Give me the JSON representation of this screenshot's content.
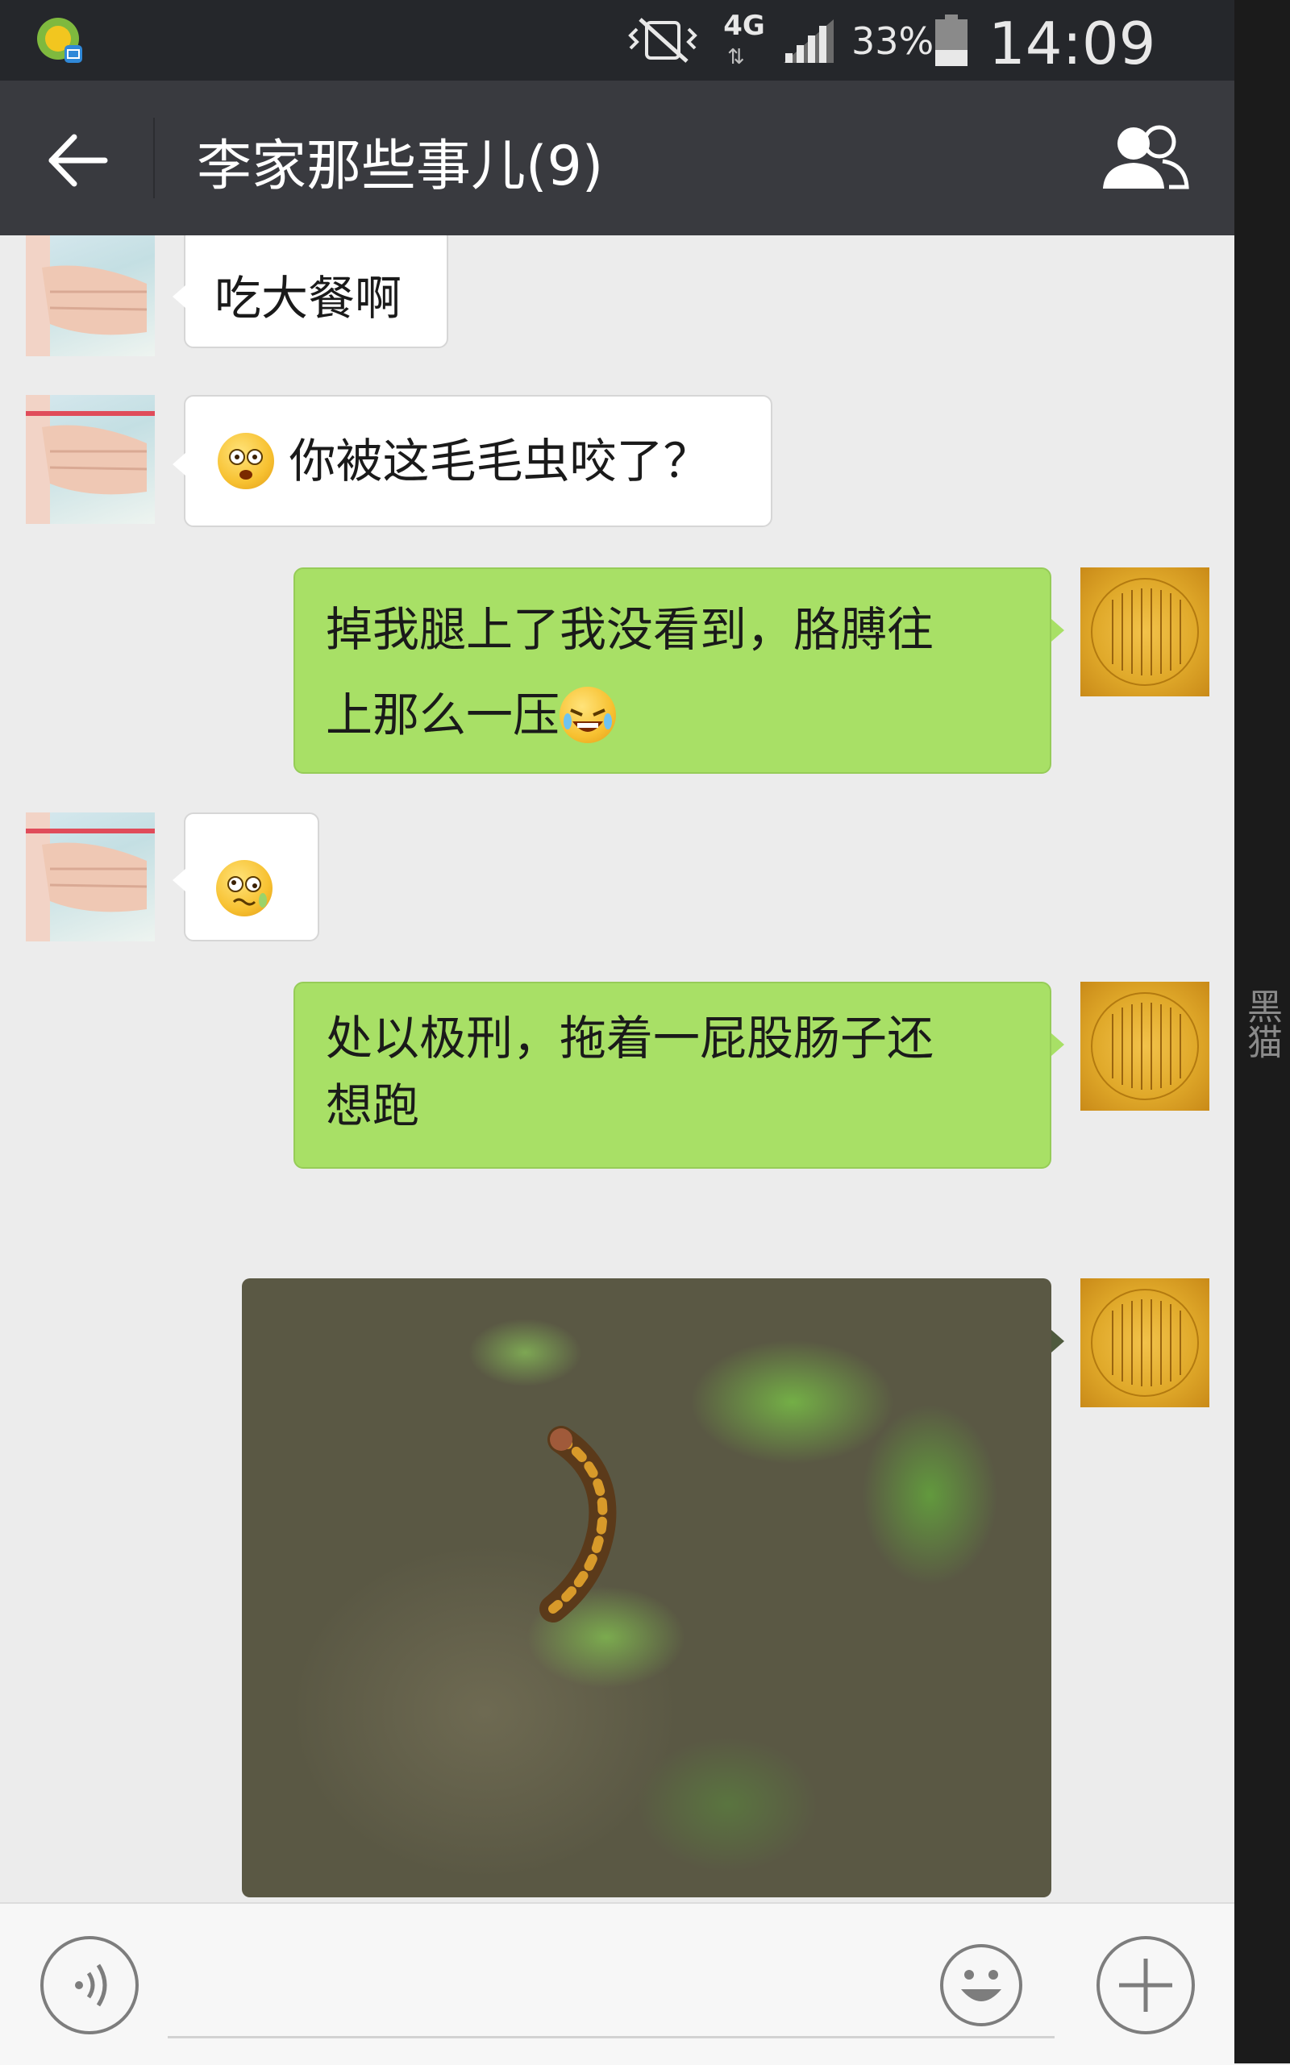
{
  "status_bar": {
    "network": "4G",
    "battery_percent": "33%",
    "time": "14:09",
    "icons": [
      "app-notification-icon",
      "vibrate-mute-icon",
      "signal-icon",
      "battery-icon"
    ]
  },
  "header": {
    "title": "李家那些事儿(9)",
    "back_icon": "back-arrow-icon",
    "members_icon": "group-members-icon"
  },
  "side_strip": {
    "text": "黑猫"
  },
  "messages": [
    {
      "sender": "friend",
      "text": "吃大餐啊"
    },
    {
      "sender": "friend",
      "emoji": "surprised-emoji",
      "text": "你被这毛毛虫咬了？"
    },
    {
      "sender": "self",
      "text_line1": "掉我腿上了我没看到，胳膊往",
      "text_line2": "上那么一压",
      "emoji": "crying-laughing-emoji"
    },
    {
      "sender": "friend",
      "emoji": "dizzy-sweat-emoji"
    },
    {
      "sender": "self",
      "text_line1": "处以极刑，拖着一屁股肠子还",
      "text_line2": "想跑"
    },
    {
      "sender": "self",
      "type": "image",
      "image_subject": "caterpillar-on-ground-photo"
    }
  ],
  "input_bar": {
    "voice_icon": "voice-input-icon",
    "emoji_icon": "emoji-picker-icon",
    "plus_icon": "more-plus-icon",
    "placeholder": ""
  },
  "colors": {
    "header_bg": "#393a3f",
    "statusbar_bg": "#25272b",
    "chat_bg": "#ececec",
    "outgoing_bubble": "#a8e066",
    "incoming_bubble": "#ffffff"
  }
}
